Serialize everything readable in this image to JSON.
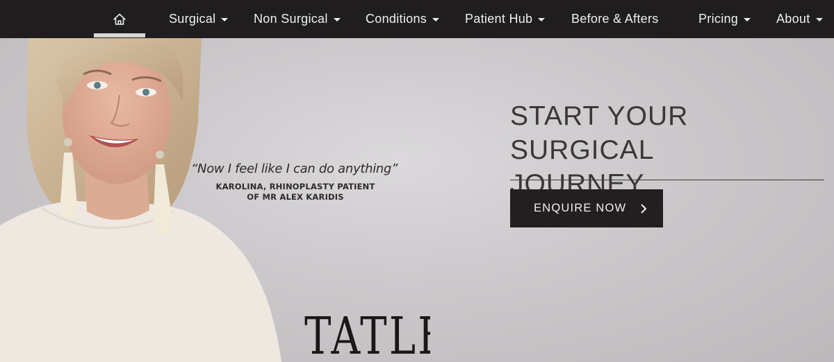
{
  "nav": {
    "home_icon": "home-icon",
    "items": [
      {
        "label": "Surgical",
        "has_dropdown": true
      },
      {
        "label": "Non Surgical",
        "has_dropdown": true
      },
      {
        "label": "Conditions",
        "has_dropdown": true
      },
      {
        "label": "Patient Hub",
        "has_dropdown": true
      },
      {
        "label": "Before & Afters",
        "has_dropdown": false
      },
      {
        "label": "Pricing",
        "has_dropdown": true
      },
      {
        "label": "About",
        "has_dropdown": true
      }
    ]
  },
  "hero": {
    "quote": "“Now I feel like I can do anything”",
    "attribution_line1": "KAROLINA, RHINOPLASTY PATIENT",
    "attribution_line2": "OF MR ALEX KARIDIS",
    "headline_line1": "START YOUR SURGICAL",
    "headline_line2": "JOURNEY",
    "cta_label": "ENQUIRE NOW",
    "cta_icon": "chevron-right-icon",
    "press_logo": "TATLER"
  },
  "colors": {
    "nav_bg": "#1f1d1d",
    "cta_bg": "#231f20",
    "hero_bg": "#c9c6c8"
  }
}
